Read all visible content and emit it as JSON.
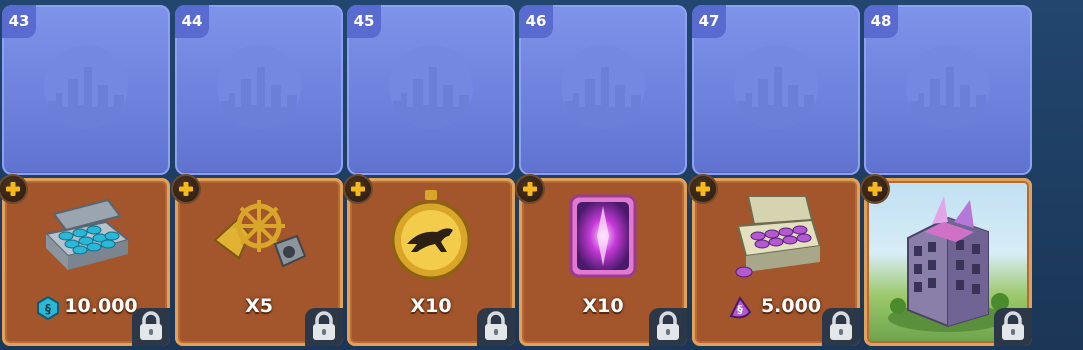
{
  "slots": [
    {
      "number": "43",
      "reward": "10.000",
      "reward_type": "sim-cash",
      "item": "cash-briefcase-icon"
    },
    {
      "number": "44",
      "reward": "X5",
      "reward_type": "item",
      "item": "speedup-items-icon"
    },
    {
      "number": "45",
      "reward": "X10",
      "reward_type": "item",
      "item": "cheetah-stopwatch-icon"
    },
    {
      "number": "46",
      "reward": "X10",
      "reward_type": "item",
      "item": "pink-portal-icon"
    },
    {
      "number": "47",
      "reward": "5.000",
      "reward_type": "neosimoleons",
      "item": "purple-briefcase-icon"
    },
    {
      "number": "48",
      "reward": "",
      "reward_type": "building",
      "item": "skyscraper-building-image"
    }
  ],
  "colors": {
    "upper_panel": "#6c80dc",
    "lower_panel": "#a3552b",
    "frame": "#e0a15a",
    "plus": "#f5b91e"
  }
}
